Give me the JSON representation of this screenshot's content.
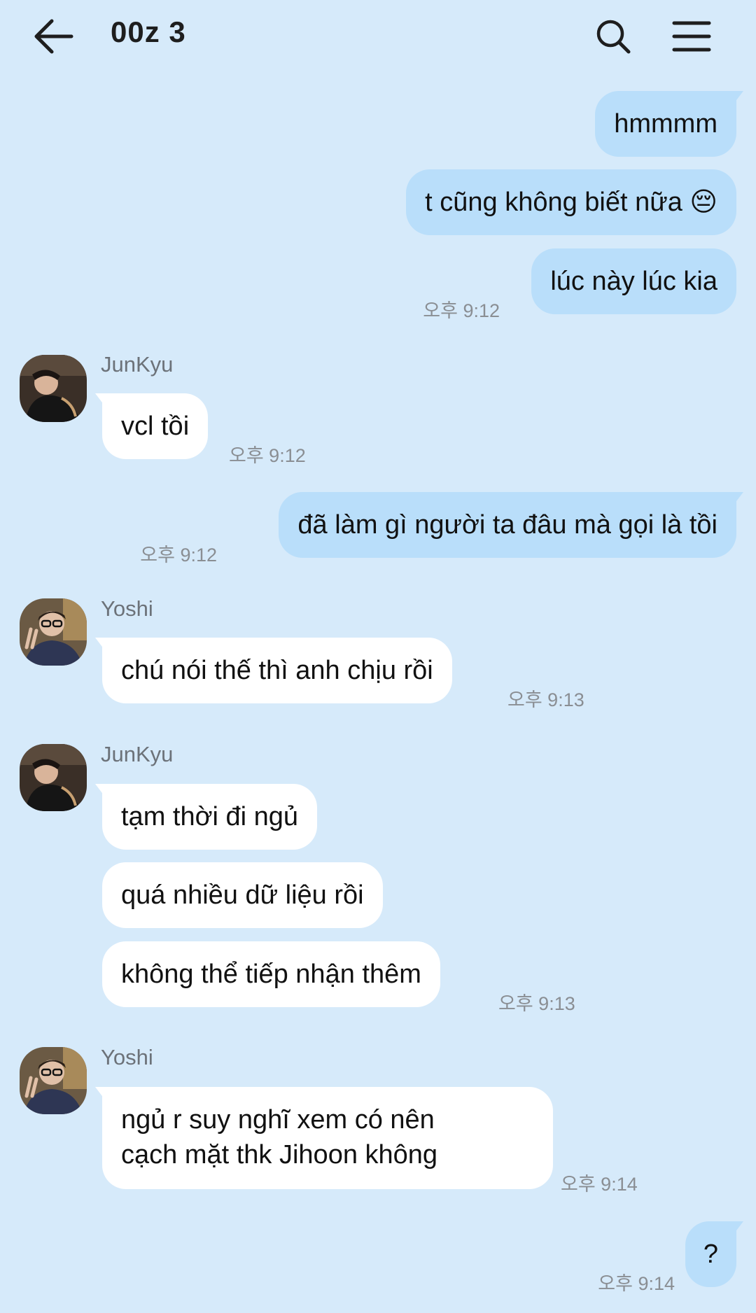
{
  "header": {
    "title": "00z 3",
    "back_icon": "arrow-left-icon",
    "search_icon": "search-icon",
    "menu_icon": "hamburger-menu-icon"
  },
  "colors": {
    "background": "#d6eafa",
    "my_bubble": "#b9defa",
    "their_bubble": "#ffffff"
  },
  "messages": [
    {
      "from": "me",
      "text": "hmmmm"
    },
    {
      "from": "me",
      "text": "t cũng không biết nữa 😔"
    },
    {
      "from": "me",
      "text": "lúc này lúc kia",
      "time": "오후 9:12"
    },
    {
      "from": "JunKyu",
      "text": "vcl tồi",
      "time": "오후 9:12"
    },
    {
      "from": "me",
      "text": "đã làm gì người ta đâu mà gọi là tồi",
      "time": "오후 9:12"
    },
    {
      "from": "Yoshi",
      "text": "chú nói thế thì anh chịu rồi",
      "time": "오후 9:13"
    },
    {
      "from": "JunKyu",
      "text": "tạm thời đi ngủ"
    },
    {
      "from": "JunKyu",
      "text": "quá nhiều dữ liệu rồi"
    },
    {
      "from": "JunKyu",
      "text": "không thể tiếp nhận thêm",
      "time": "오후 9:13"
    },
    {
      "from": "Yoshi",
      "text_line1": "ngủ r suy nghĩ xem có nên",
      "text_line2": "cạch mặt thk Jihoon không",
      "time": "오후 9:14"
    },
    {
      "from": "me",
      "text": "?",
      "time": "오후 9:14"
    }
  ],
  "senders": {
    "junkyu": "JunKyu",
    "yoshi": "Yoshi"
  }
}
